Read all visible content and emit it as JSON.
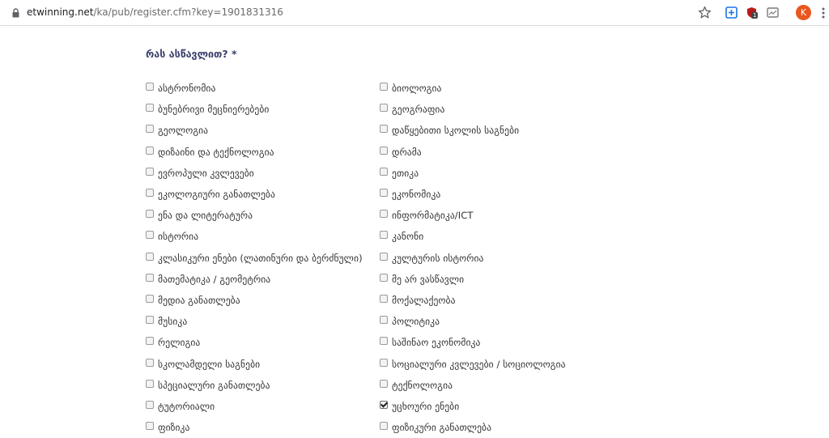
{
  "browser": {
    "url_host": "etwinning.net",
    "url_path": "/ka/pub/register.cfm?key=1901831316",
    "avatar_letter": "K",
    "ext_badge": "1",
    "icons": [
      "lock-icon",
      "star-icon",
      "extension-icon",
      "shield-extension-icon",
      "screenshot-extension-icon",
      "kebab-menu-icon"
    ],
    "avatar_color": "#e8571e"
  },
  "form": {
    "question": "რას ასწავლით? *",
    "left_options": [
      {
        "label": "ასტრონომია",
        "checked": false
      },
      {
        "label": "ბუნებრივი მეცნიერებები",
        "checked": false
      },
      {
        "label": "გეოლოგია",
        "checked": false
      },
      {
        "label": "დიზაინი და ტექნოლოგია",
        "checked": false
      },
      {
        "label": "ევროპული კვლევები",
        "checked": false
      },
      {
        "label": "ეკოლოგიური განათლება",
        "checked": false
      },
      {
        "label": "ენა და ლიტერატურა",
        "checked": false
      },
      {
        "label": "ისტორია",
        "checked": false
      },
      {
        "label": "კლასიკური ენები (ლათინური და ბერძნული)",
        "checked": false
      },
      {
        "label": "მათემატიკა / გეომეტრია",
        "checked": false
      },
      {
        "label": "მედია განათლება",
        "checked": false
      },
      {
        "label": "მუსიკა",
        "checked": false
      },
      {
        "label": "რელიგია",
        "checked": false
      },
      {
        "label": "სკოლამდელი საგნები",
        "checked": false
      },
      {
        "label": "სპეციალური განათლება",
        "checked": false
      },
      {
        "label": "ტუტორიალი",
        "checked": false
      },
      {
        "label": "ფიზიკა",
        "checked": false
      }
    ],
    "right_options": [
      {
        "label": "ბიოლოგია",
        "checked": false
      },
      {
        "label": "გეოგრაფია",
        "checked": false
      },
      {
        "label": "დაწყებითი სკოლის საგნები",
        "checked": false
      },
      {
        "label": "დრამა",
        "checked": false
      },
      {
        "label": "ეთიკა",
        "checked": false
      },
      {
        "label": "ეკონომიკა",
        "checked": false
      },
      {
        "label": "ინფორმატიკა/ICT",
        "checked": false
      },
      {
        "label": "კანონი",
        "checked": false
      },
      {
        "label": "კულტურის ისტორია",
        "checked": false
      },
      {
        "label": "მე არ ვასწავლი",
        "checked": false
      },
      {
        "label": "მოქალაქეობა",
        "checked": false
      },
      {
        "label": "პოლიტიკა",
        "checked": false
      },
      {
        "label": "საშინაო ეკონომიკა",
        "checked": false
      },
      {
        "label": "სოციალური კვლევები / სოციოლოგია",
        "checked": false
      },
      {
        "label": "ტექნოლოგია",
        "checked": false
      },
      {
        "label": "უცხოური ენები",
        "checked": true
      },
      {
        "label": "ფიზიკური განათლება",
        "checked": false
      }
    ],
    "colors": {
      "question": "#3a3f6b",
      "label": "#333333"
    }
  }
}
